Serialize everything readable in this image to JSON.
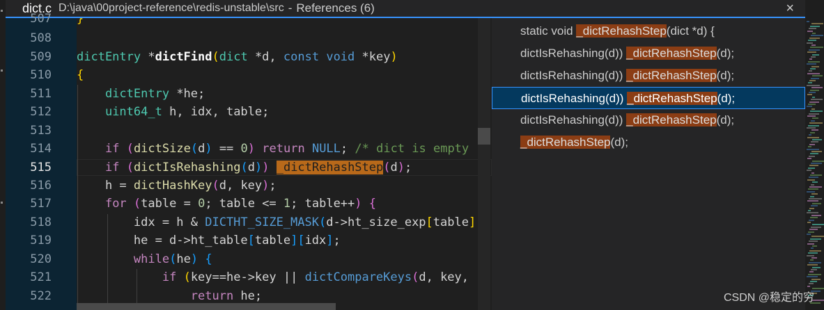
{
  "peek": {
    "filename": "dict.c",
    "path": "D:\\java\\00project-reference\\redis-unstable\\src",
    "separator": "-",
    "title": "References (6)",
    "close_icon": "×"
  },
  "code": {
    "top_partial": {
      "number": "507",
      "text": "}"
    },
    "active_line": "515",
    "lines": [
      {
        "number": "508"
      },
      {
        "number": "509"
      },
      {
        "number": "510"
      },
      {
        "number": "511"
      },
      {
        "number": "512"
      },
      {
        "number": "513"
      },
      {
        "number": "514"
      },
      {
        "number": "515"
      },
      {
        "number": "516"
      },
      {
        "number": "517"
      },
      {
        "number": "518"
      },
      {
        "number": "519"
      },
      {
        "number": "520"
      },
      {
        "number": "521"
      },
      {
        "number": "522"
      }
    ]
  },
  "references": [
    {
      "before": "static void ",
      "match": "_dictRehashStep",
      "after": "(dict *d) {",
      "selected": false
    },
    {
      "before": "dictIsRehashing(d)) ",
      "match": "_dictRehashStep",
      "after": "(d);",
      "selected": false
    },
    {
      "before": "dictIsRehashing(d)) ",
      "match": "_dictRehashStep",
      "after": "(d);",
      "selected": false
    },
    {
      "before": "dictIsRehashing(d)) ",
      "match": "_dictRehashStep",
      "after": "(d);",
      "selected": true
    },
    {
      "before": "dictIsRehashing(d)) ",
      "match": "_dictRehashStep",
      "after": "(d);",
      "selected": false
    },
    {
      "before": "",
      "match": "_dictRehashStep",
      "after": "(d);",
      "selected": false
    }
  ],
  "watermark": "CSDN @稳定的穷"
}
